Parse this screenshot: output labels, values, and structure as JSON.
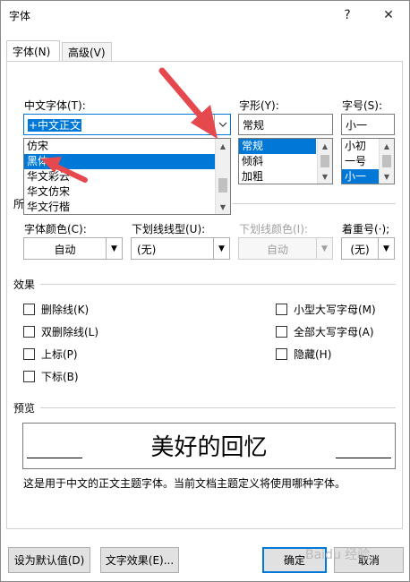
{
  "window": {
    "title": "字体",
    "help": "?",
    "close": "✕"
  },
  "tabs": [
    {
      "label": "字体(N)"
    },
    {
      "label": "高级(V)"
    }
  ],
  "chinese_font": {
    "label": "中文字体(T):",
    "value": "+中文正文",
    "list": [
      "仿宋",
      "黑体",
      "华文彩云",
      "华文仿宋",
      "华文行楷"
    ],
    "selected_index": 1
  },
  "font_style": {
    "label": "字形(Y):",
    "value": "常规",
    "list": [
      "常规",
      "倾斜",
      "加粗"
    ],
    "selected_index": 0
  },
  "font_size": {
    "label": "字号(S):",
    "value": "小一",
    "list": [
      "小初",
      "一号",
      "小一"
    ],
    "selected_index": 2
  },
  "all_text_label": "所",
  "font_color": {
    "label": "字体颜色(C):",
    "value": "自动"
  },
  "underline_style": {
    "label": "下划线线型(U):",
    "value": "(无)"
  },
  "underline_color": {
    "label": "下划线颜色(I):",
    "value": "自动"
  },
  "emphasis": {
    "label": "着重号(·);",
    "value": "(无)"
  },
  "effects": {
    "heading": "效果",
    "left": [
      "删除线(K)",
      "双删除线(L)",
      "上标(P)",
      "下标(B)"
    ],
    "right": [
      "小型大写字母(M)",
      "全部大写字母(A)",
      "隐藏(H)"
    ]
  },
  "preview": {
    "heading": "预览",
    "sample": "美好的回忆",
    "note": "这是用于中文的正文主题字体。当前文档主题定义将使用哪种字体。"
  },
  "buttons": {
    "set_default": "设为默认值(D)",
    "text_effects": "文字效果(E)...",
    "ok": "确定",
    "cancel": "取消"
  },
  "watermark": "Baidu 经验",
  "colors": {
    "accent": "#0078d7",
    "annotation_arrow": "#e5484d"
  }
}
